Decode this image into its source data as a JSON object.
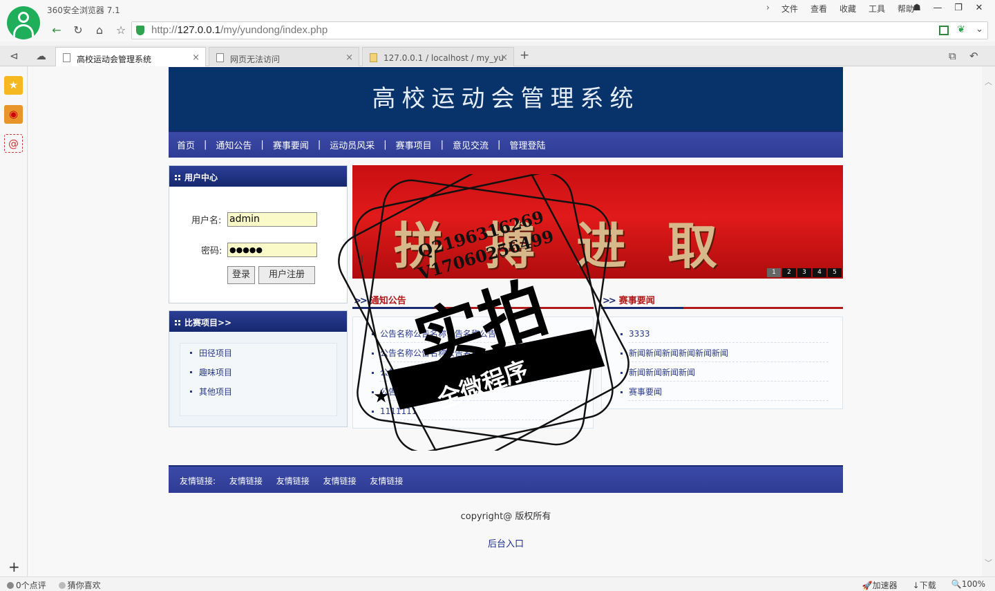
{
  "browser": {
    "app_title": "360安全浏览器 7.1",
    "menu": [
      "文件",
      "查看",
      "收藏",
      "工具",
      "帮助"
    ],
    "url_prefix": "http://",
    "url_host": "127.0.0.1",
    "url_path": "/my/yundong/index.php",
    "tabs": [
      {
        "label": "高校运动会管理系统"
      },
      {
        "label": "网页无法访问"
      },
      {
        "label": "127.0.0.1 / localhost / my_yu"
      }
    ],
    "status_left": [
      "0个点评",
      "猜你喜欢"
    ],
    "status_right": [
      "加速器",
      "下载",
      "100%"
    ]
  },
  "site": {
    "title": "高校运动会管理系统",
    "nav": [
      "首页",
      "通知公告",
      "赛事要闻",
      "运动员风采",
      "赛事项目",
      "意见交流",
      "管理登陆"
    ],
    "user_center": {
      "title": "用户中心",
      "username_label": "用户名:",
      "username_value": "admin",
      "password_label": "密码:",
      "password_value": "●●●●●",
      "login_button": "登录",
      "register_button": "用户注册"
    },
    "categories": {
      "title": "比赛项目>>",
      "items": [
        "田径项目",
        "趣味项目",
        "其他项目"
      ]
    },
    "slider": {
      "slogan": "拼搏进取",
      "pages": [
        "1",
        "2",
        "3",
        "4",
        "5"
      ]
    },
    "notices": {
      "title": "通知公告",
      "items": [
        "公告名称公告名称公告名称公告",
        "公告名称公告名称公告名称",
        "公告名称公告名称公告",
        "公告名称公告名称",
        "1111111"
      ]
    },
    "news": {
      "title": "赛事要闻",
      "items": [
        "3333",
        "新闻新闻新闻新闻新闻新闻",
        "新闻新闻新闻新闻",
        "赛事要闻"
      ]
    },
    "friend_links": {
      "label": "友情链接:",
      "items": [
        "友情链接",
        "友情链接",
        "友情链接",
        "友情链接"
      ]
    },
    "copyright": "copyright@ 版权所有",
    "admin_entry": "后台入口"
  },
  "watermark": {
    "qq": "Q2196316269",
    "wechat": "V17060256499",
    "main": "实拍",
    "sub": "全微程序"
  },
  "colors": {
    "header_bg": "#07326a",
    "nav_bg": "#3b4aa7",
    "accent_red": "#b01a1a",
    "link_blue": "#2a3a8a"
  }
}
